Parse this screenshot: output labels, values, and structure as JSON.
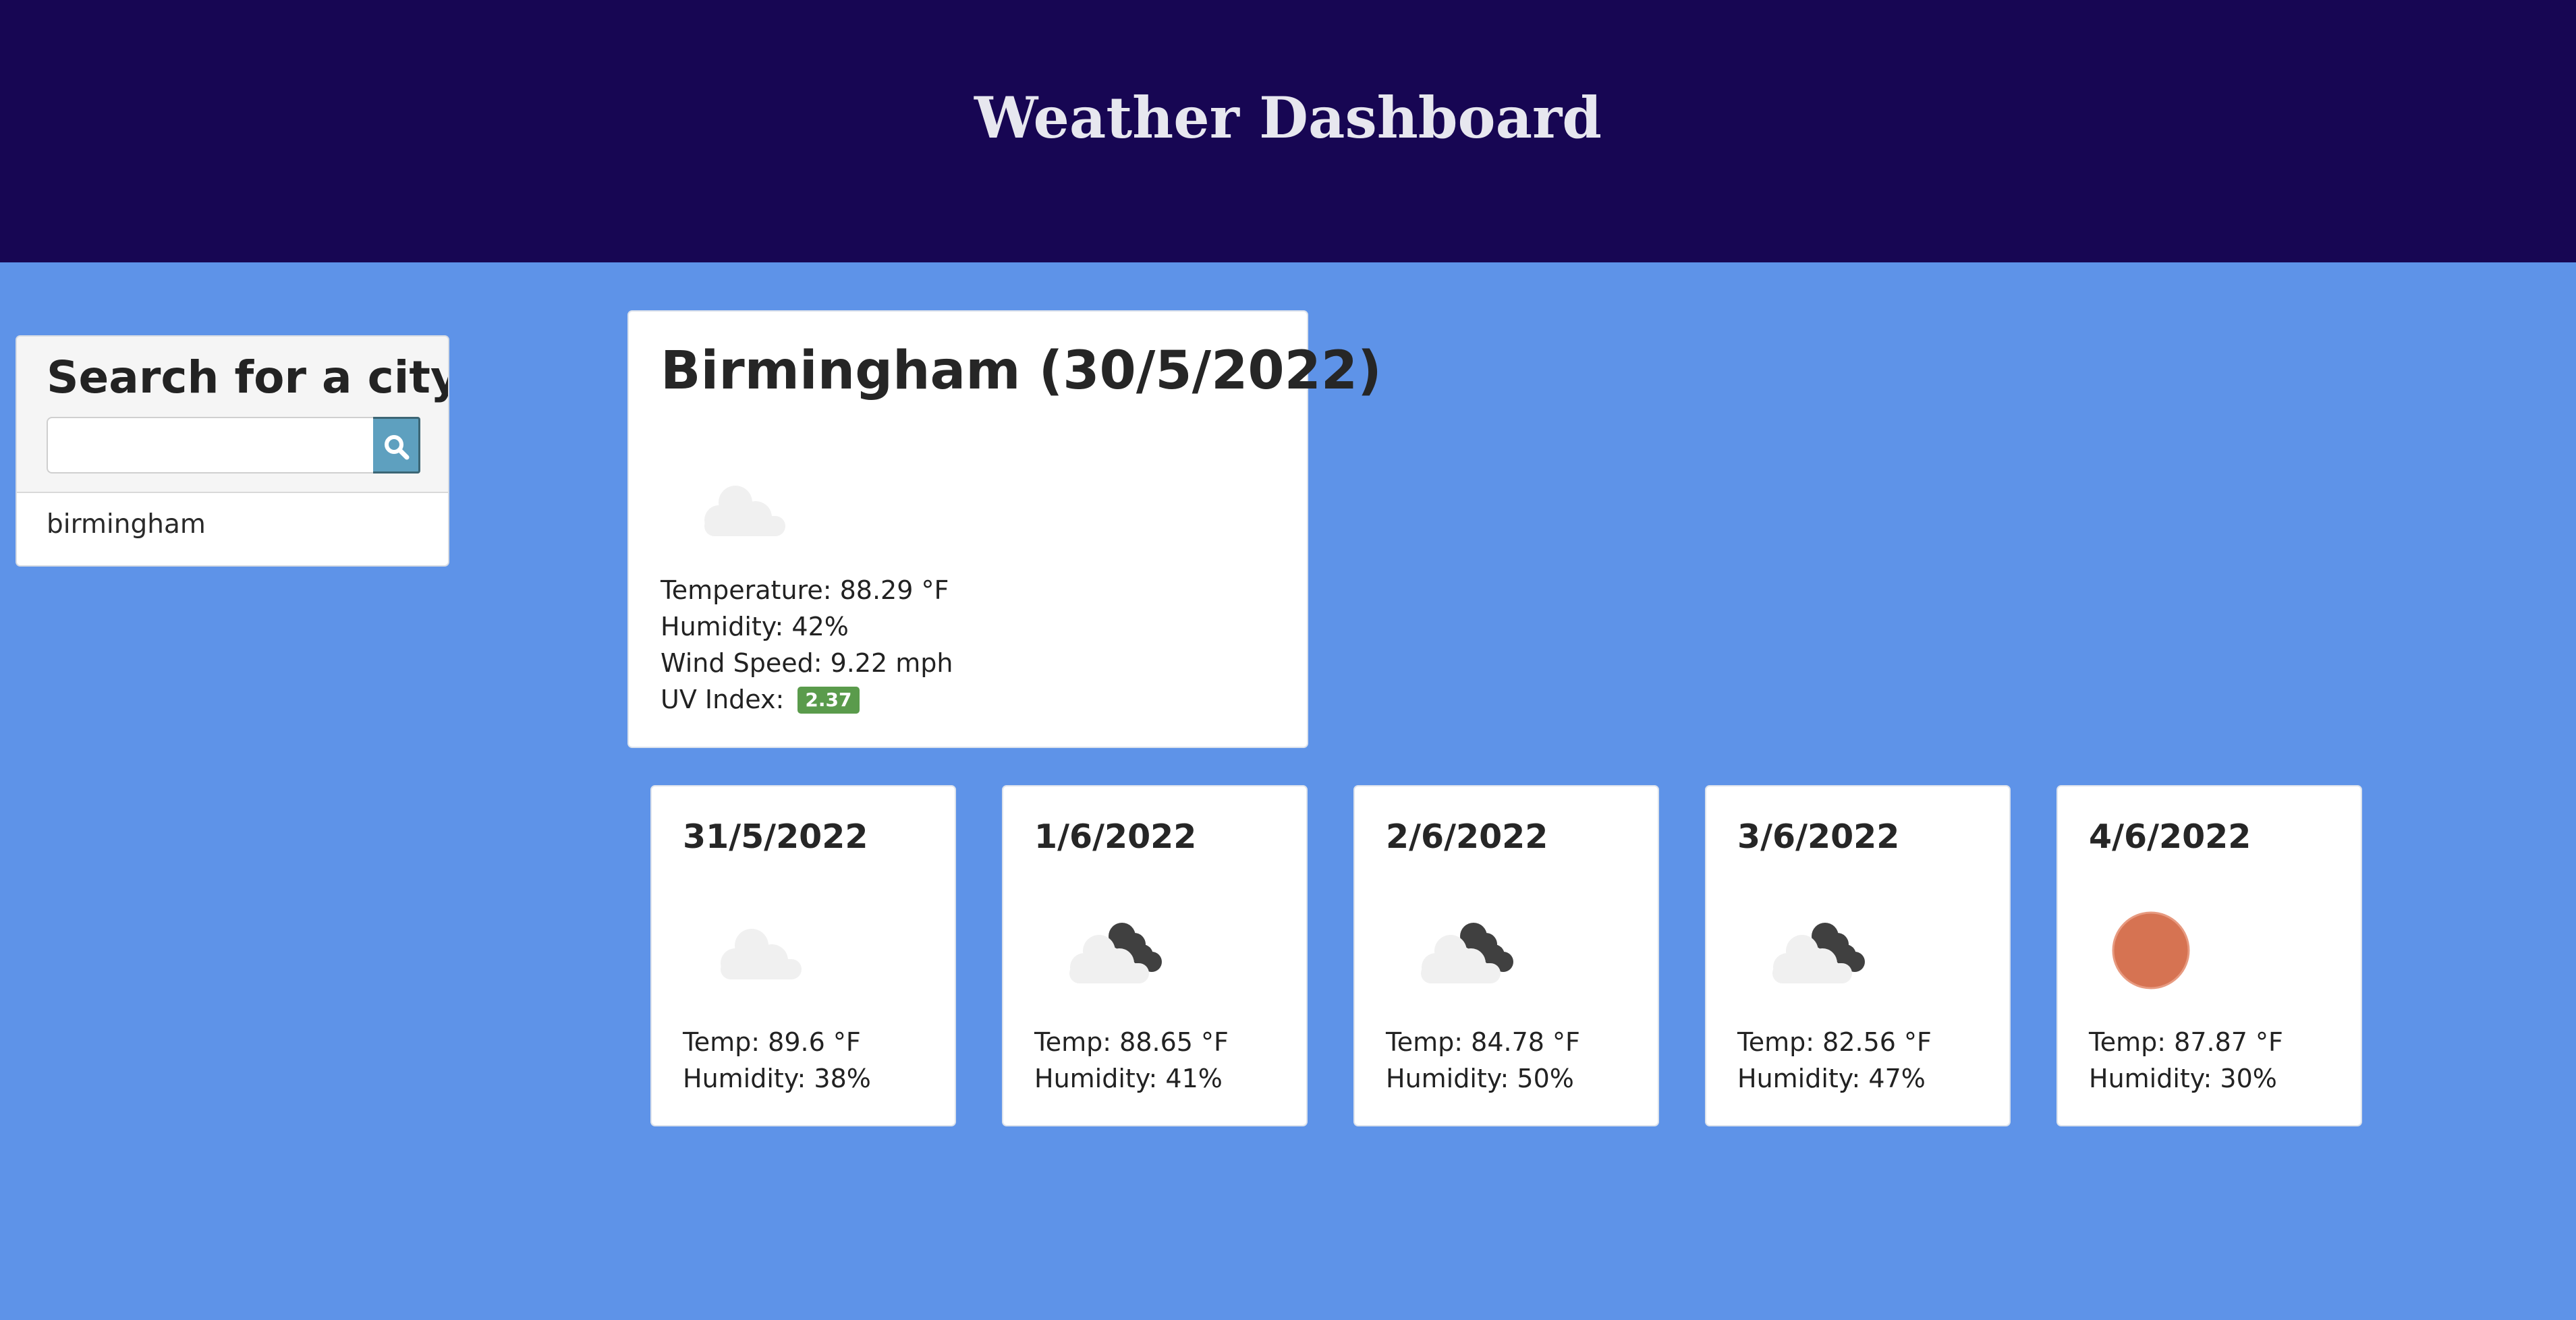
{
  "header": {
    "title": "Weather Dashboard"
  },
  "search": {
    "label": "Search for a city:",
    "input_value": "",
    "placeholder": "",
    "button_icon": "search-icon",
    "history": [
      "birmingham"
    ]
  },
  "current": {
    "title": "Birmingham (30/5/2022)",
    "icon": "cloud-icon",
    "temperature": "Temperature: 88.29 °F",
    "humidity": "Humidity: 42%",
    "wind": "Wind Speed: 9.22 mph",
    "uv_label": "UV Index:",
    "uv_value": "2.37",
    "uv_color": "#5a9b4c"
  },
  "forecast": [
    {
      "date": "31/5/2022",
      "icon": "cloud-icon",
      "temp": "Temp: 89.6 °F",
      "humidity": "Humidity: 38%"
    },
    {
      "date": "1/6/2022",
      "icon": "broken-clouds-icon",
      "temp": "Temp: 88.65 °F",
      "humidity": "Humidity: 41%"
    },
    {
      "date": "2/6/2022",
      "icon": "broken-clouds-icon",
      "temp": "Temp: 84.78 °F",
      "humidity": "Humidity: 50%"
    },
    {
      "date": "3/6/2022",
      "icon": "broken-clouds-icon",
      "temp": "Temp: 82.56 °F",
      "humidity": "Humidity: 47%"
    },
    {
      "date": "4/6/2022",
      "icon": "sun-icon",
      "temp": "Temp: 87.87 °F",
      "humidity": "Humidity: 30%"
    }
  ],
  "colors": {
    "header_bg": "#170653",
    "page_bg": "#5e93e8",
    "search_button": "#5ea0bf",
    "sun": "#d67352"
  }
}
